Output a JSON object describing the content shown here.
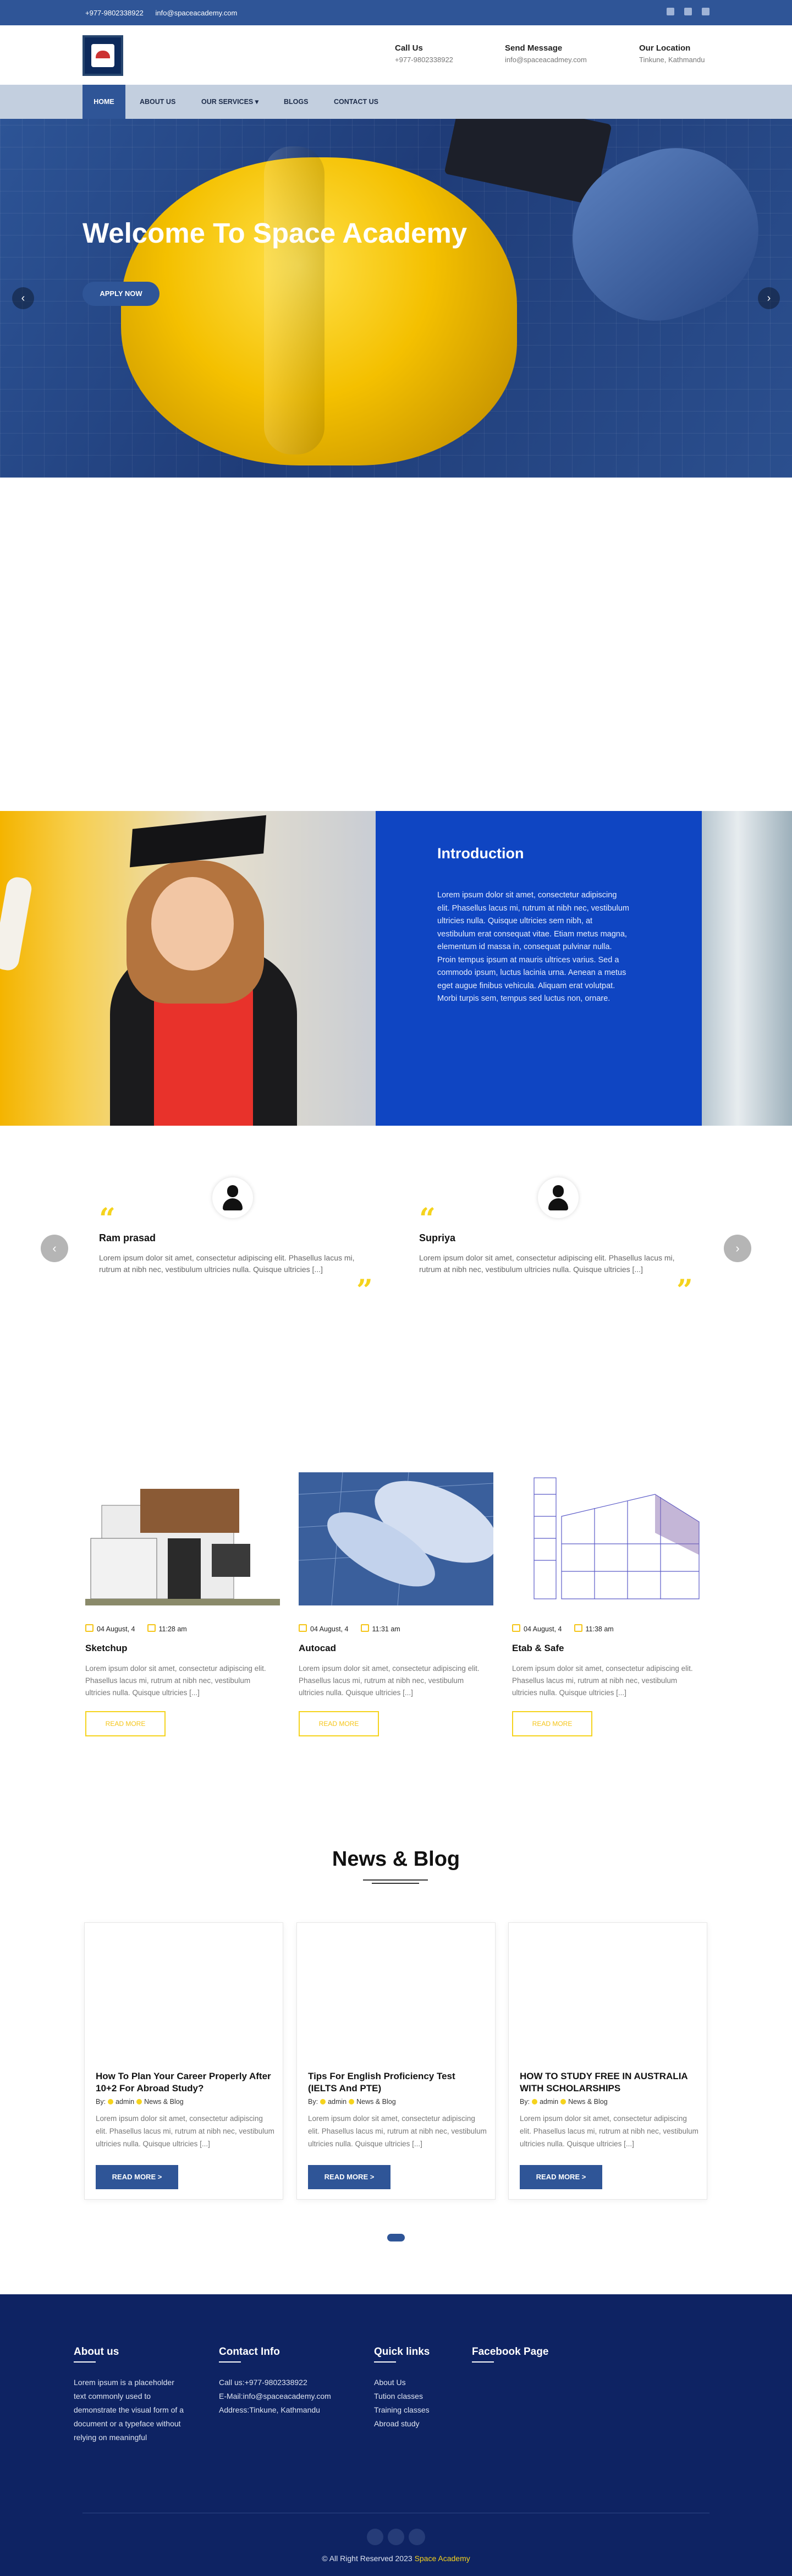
{
  "topbar": {
    "phone": "+977-9802338922",
    "email": "info@spaceacademy.com"
  },
  "contacts": [
    {
      "title": "Call Us",
      "value": "+977-9802338922"
    },
    {
      "title": "Send Message",
      "value": "info@spaceacadmey.com"
    },
    {
      "title": "Our Location",
      "value": "Tinkune, Kathmandu"
    }
  ],
  "nav": {
    "home": "HOME",
    "about": "ABOUT US",
    "services": "OUR SERVICES",
    "blogs": "BLOGS",
    "contact": "CONTACT US"
  },
  "hero": {
    "title": "Welcome To Space Academy",
    "button": "APPLY NOW"
  },
  "intro": {
    "title": "Introduction",
    "text": "Lorem ipsum dolor sit amet, consectetur adipiscing elit. Phasellus lacus mi, rutrum at nibh nec, vestibulum ultricies nulla. Quisque ultricies sem nibh, at vestibulum erat consequat vitae. Etiam metus magna, elementum id massa in, consequat pulvinar nulla. Proin tempus ipsum at mauris ultrices varius. Sed a commodo ipsum, luctus lacinia urna. Aenean a metus eget augue finibus vehicula. Aliquam erat volutpat. Morbi turpis sem, tempus sed luctus non, ornare."
  },
  "testimonials": [
    {
      "name": "Ram prasad",
      "text": "Lorem ipsum dolor sit amet, consectetur adipiscing elit. Phasellus lacus mi, rutrum at nibh nec, vestibulum ultricies nulla. Quisque ultricies [...]"
    },
    {
      "name": "Supriya",
      "text": "Lorem ipsum dolor sit amet, consectetur adipiscing elit. Phasellus lacus mi, rutrum at nibh nec, vestibulum ultricies nulla. Quisque ultricies [...]"
    }
  ],
  "services": [
    {
      "date": "04 August, 4",
      "time": "11:28 am",
      "title": "Sketchup",
      "text": "Lorem ipsum dolor sit amet, consectetur adipiscing elit. Phasellus lacus mi, rutrum at nibh nec, vestibulum ultricies nulla. Quisque ultricies [...]",
      "button": "READ MORE"
    },
    {
      "date": "04 August, 4",
      "time": "11:31 am",
      "title": "Autocad",
      "text": "Lorem ipsum dolor sit amet, consectetur adipiscing elit. Phasellus lacus mi, rutrum at nibh nec, vestibulum ultricies nulla. Quisque ultricies [...]",
      "button": "READ MORE"
    },
    {
      "date": "04 August, 4",
      "time": "11:38 am",
      "title": "Etab & Safe",
      "text": "Lorem ipsum dolor sit amet, consectetur adipiscing elit. Phasellus lacus mi, rutrum at nibh nec, vestibulum ultricies nulla. Quisque ultricies [...]",
      "button": "READ MORE"
    }
  ],
  "news": {
    "title": "News & Blog",
    "cards": [
      {
        "title": "How To Plan Your Career Properly After 10+2 For Abroad Study?",
        "by": "By:",
        "author": "admin",
        "category": "News & Blog",
        "text": "Lorem ipsum dolor sit amet, consectetur adipiscing elit. Phasellus lacus mi, rutrum at nibh nec, vestibulum ultricies nulla. Quisque ultricies [...]",
        "button": "READ MORE >"
      },
      {
        "title": "Tips For English Proficiency Test (IELTS And PTE)",
        "by": "By:",
        "author": "admin",
        "category": "News & Blog",
        "text": "Lorem ipsum dolor sit amet, consectetur adipiscing elit. Phasellus lacus mi, rutrum at nibh nec, vestibulum ultricies nulla. Quisque ultricies [...]",
        "button": "READ MORE >"
      },
      {
        "title": "HOW TO STUDY FREE IN AUSTRALIA WITH SCHOLARSHIPS",
        "by": "By:",
        "author": "admin",
        "category": "News & Blog",
        "text": "Lorem ipsum dolor sit amet, consectetur adipiscing elit. Phasellus lacus mi, rutrum at nibh nec, vestibulum ultricies nulla. Quisque ultricies [...]",
        "button": "READ MORE >"
      }
    ]
  },
  "footer": {
    "about_title": "About us",
    "about_text": "Lorem ipsum is a placeholder text commonly used to demonstrate the visual form of a document or a typeface without relying on meaningful",
    "contact_title": "Contact Info",
    "contact_lines": [
      "Call us:+977-9802338922",
      "E-Mail:info@spaceacademy.com",
      "Address:Tinkune, Kathmandu"
    ],
    "links_title": "Quick links",
    "links": [
      "About Us",
      "Tution classes",
      "Training classes",
      "Abroad study"
    ],
    "facebook_title": "Facebook Page",
    "copyright": "© All Right Reserved 2023",
    "brand": "Space Academy"
  },
  "colors": {
    "primary": "#2f5597",
    "intro_blue": "#0f45c2",
    "accent": "#f5d31d",
    "footer": "#0e2363"
  },
  "icons": [
    "facebook-icon",
    "youtube-icon",
    "instagram-icon",
    "calendar-icon",
    "clock-icon",
    "user-icon",
    "folder-icon",
    "quote-icon"
  ]
}
